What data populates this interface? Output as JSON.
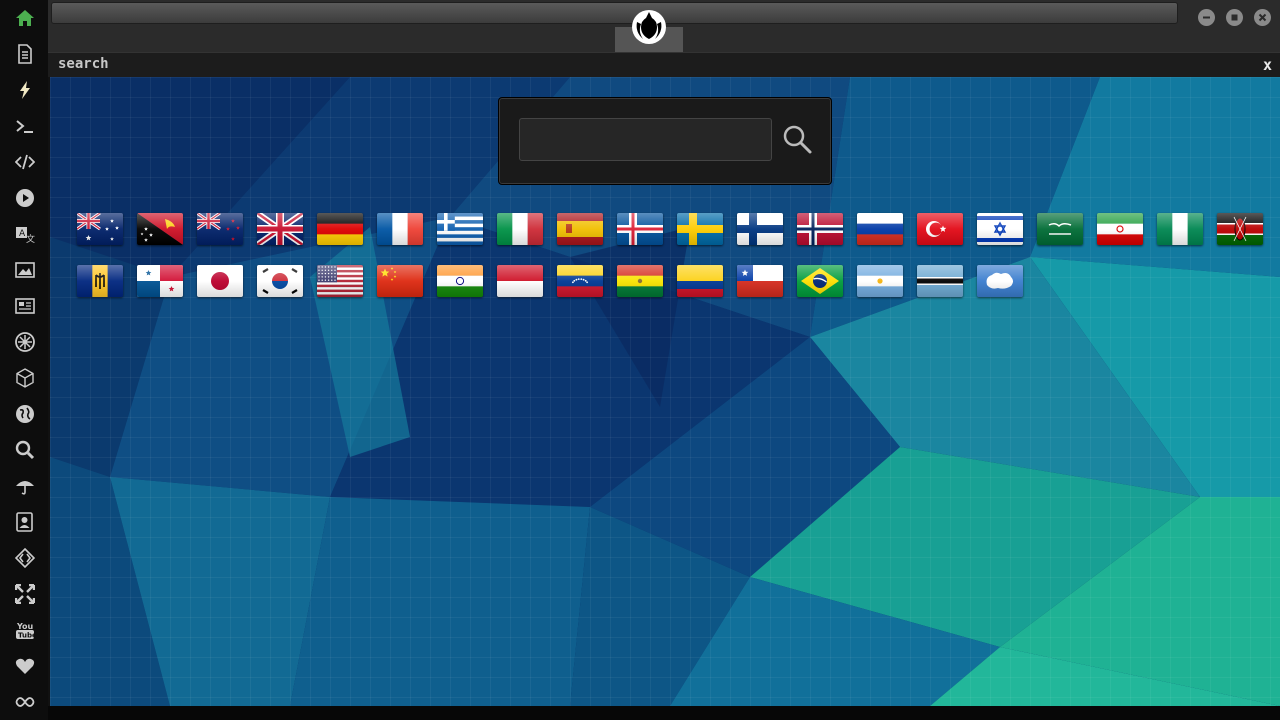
{
  "panel": {
    "title": "search",
    "close_label": "x"
  },
  "search": {
    "value": "",
    "placeholder": ""
  },
  "sidebar": {
    "items": [
      "home-icon",
      "document-icon",
      "lightning-icon",
      "terminal-icon",
      "code-icon",
      "play-icon",
      "translate-icon",
      "image-icon",
      "news-icon",
      "rebel-alliance-icon",
      "cube-icon",
      "globe-icon",
      "search-icon",
      "umbrella-icon",
      "contacts-icon",
      "source-code-icon",
      "expand-icon",
      "youtube-icon",
      "heart-icon",
      "infinity-icon"
    ]
  },
  "window_controls": [
    "minimize-icon",
    "maximize-icon",
    "close-icon"
  ],
  "flags": {
    "row1": [
      "australia",
      "papua-new-guinea",
      "new-zealand",
      "united-kingdom",
      "germany",
      "france",
      "greece",
      "italy",
      "spain",
      "iceland",
      "sweden",
      "finland",
      "norway",
      "russia",
      "turkey",
      "israel",
      "saudi-arabia",
      "iran",
      "nigeria",
      "kenya"
    ],
    "row2": [
      "barbados",
      "panama",
      "japan",
      "south-korea",
      "united-states",
      "china",
      "india",
      "indonesia",
      "venezuela",
      "bolivia",
      "colombia",
      "chile",
      "brazil",
      "argentina",
      "botswana",
      "antarctica"
    ]
  },
  "colors": {
    "accent_home": "#4caf50",
    "sidebar_bg": "#0d0d0d",
    "bg_deep": "#0a2a5e",
    "bg_teal": "#1fa58e"
  }
}
